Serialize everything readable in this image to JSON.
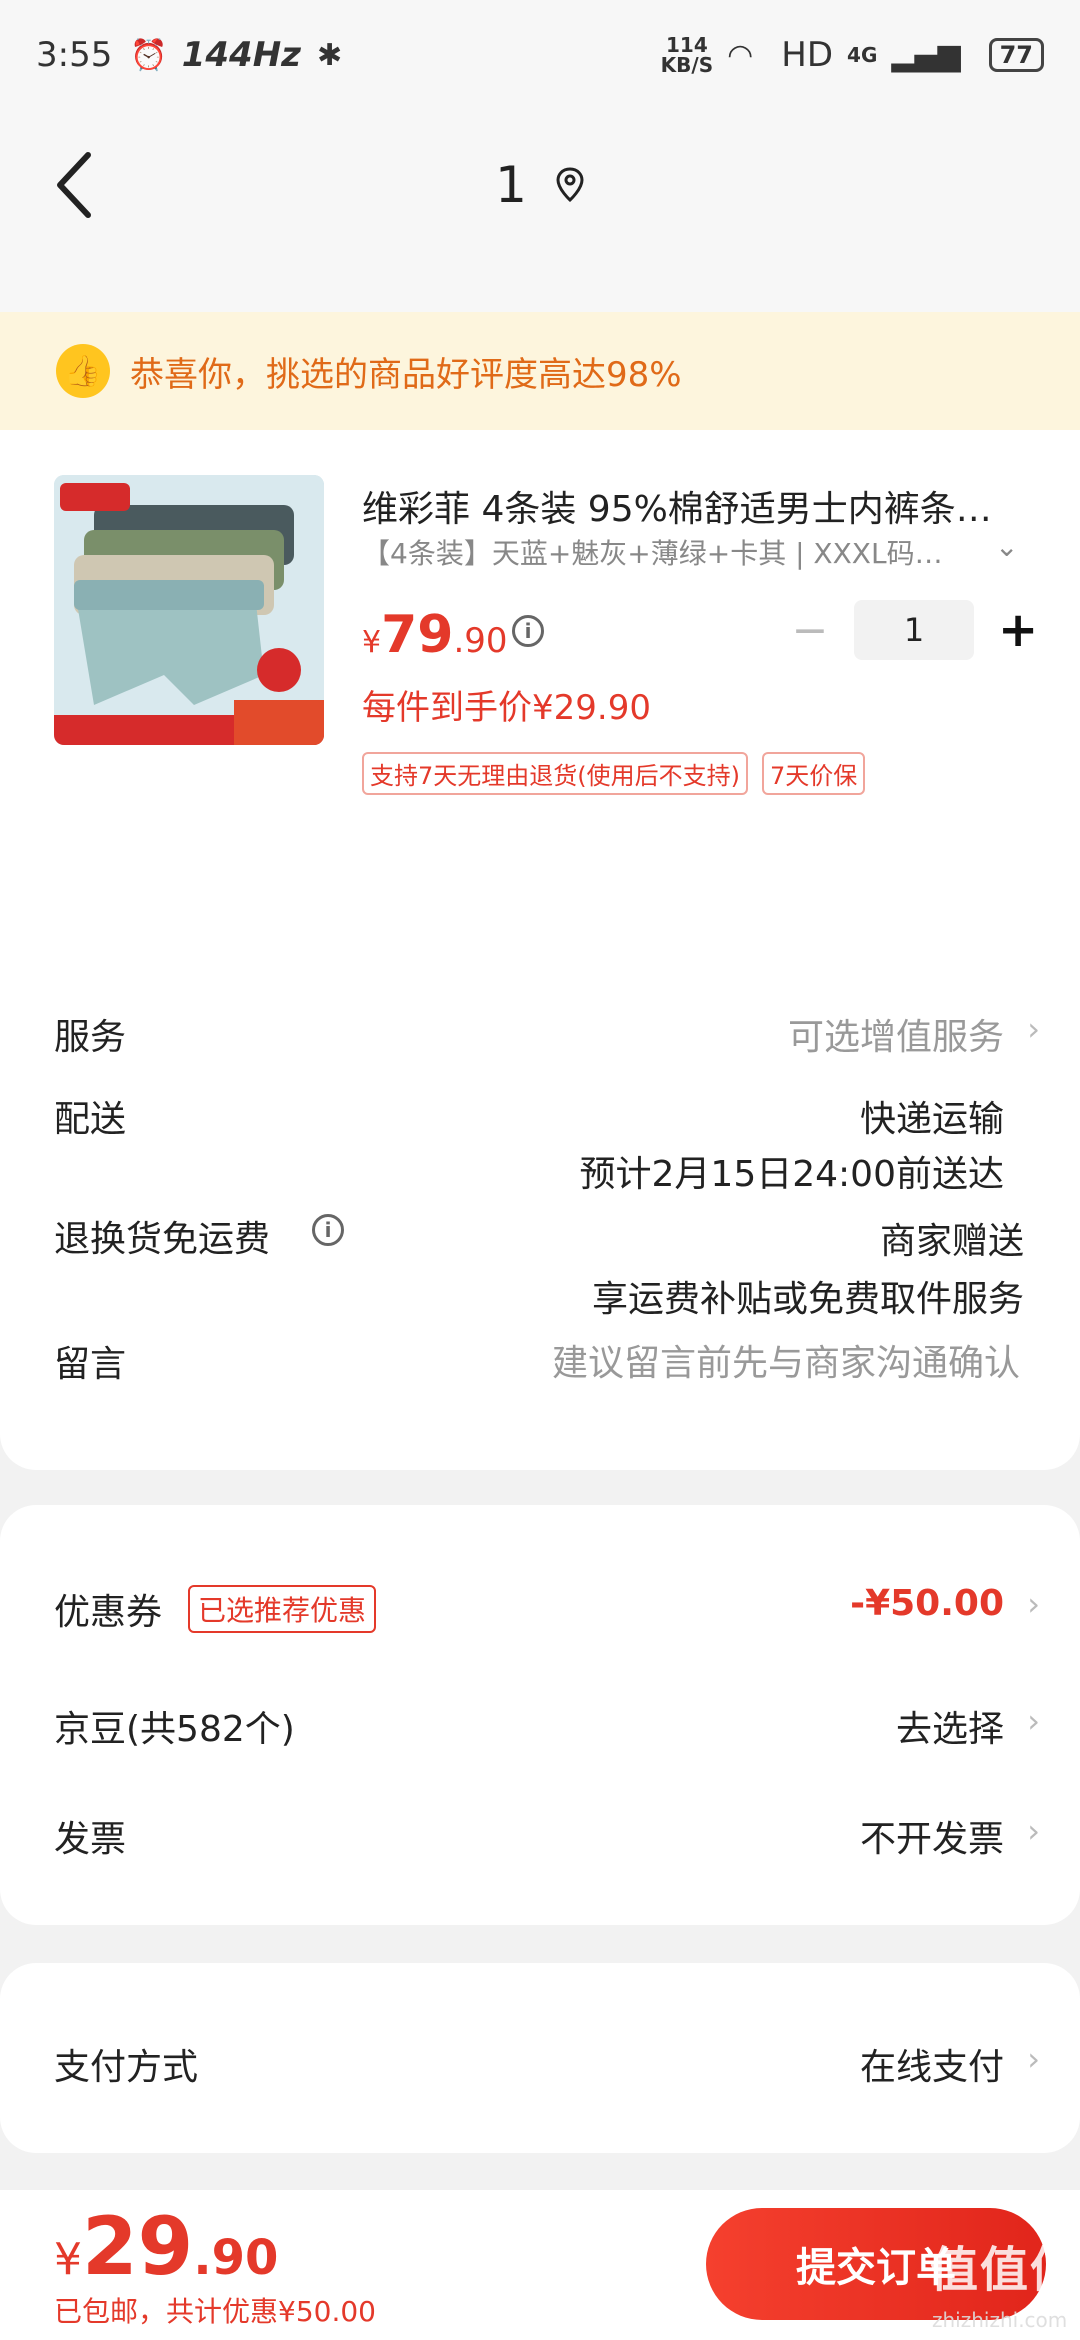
{
  "status_bar": {
    "time": "3:55",
    "refresh_rate": "144Hz",
    "net_speed_value": "114",
    "net_speed_unit": "KB/S",
    "hd": "HD",
    "network": "4G",
    "battery": "77"
  },
  "nav": {
    "title": "1"
  },
  "praise_banner": {
    "text": "恭喜你，挑选的商品好评度高达98%"
  },
  "product": {
    "title": "维彩菲 4条装 95%棉舒适男士内裤条…",
    "spec": "【4条装】天蓝+魅灰+薄绿+卡其 | XXXL码…",
    "price_yen": "¥",
    "price_int": "79",
    "price_dec": ".90",
    "quantity": "1",
    "unit_price": "每件到手价¥29.90",
    "tags": [
      "支持7天无理由退货(使用后不支持)",
      "7天价保"
    ]
  },
  "rows": {
    "service_label": "服务",
    "service_value": "可选增值服务",
    "delivery_label": "配送",
    "delivery_value": "快递运输",
    "delivery_eta": "预计2月15日24:00前送达",
    "return_label": "退换货免运费",
    "return_value": "商家赠送",
    "return_desc": "享运费补贴或免费取件服务",
    "message_label": "留言",
    "message_placeholder": "建议留言前先与商家沟通确认"
  },
  "discounts": {
    "coupon_label": "优惠券",
    "coupon_tag": "已选推荐优惠",
    "coupon_value": "-¥50.00",
    "jingdou_label": "京豆(共582个)",
    "jingdou_value": "去选择",
    "invoice_label": "发票",
    "invoice_value": "不开发票"
  },
  "payment": {
    "label": "支付方式",
    "value": "在线支付"
  },
  "footer": {
    "total_yen": "¥",
    "total_int": "29",
    "total_dec": ".90",
    "total_sub": "已包邮，共计优惠¥50.00",
    "submit_label": "提交订单"
  },
  "watermark": {
    "text": "值值值",
    "site": "zhizhizhi.com"
  },
  "colors": {
    "accent": "#e4392a",
    "banner_bg": "#fdf5dd",
    "banner_text": "#e06a18"
  }
}
